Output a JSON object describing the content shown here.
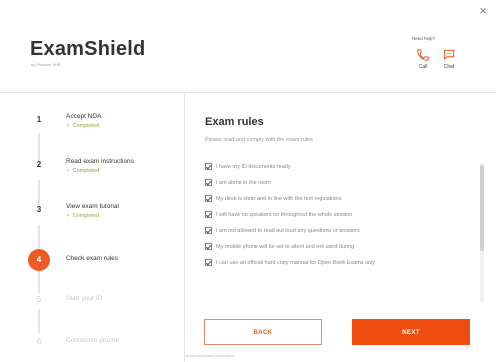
{
  "window": {
    "close_glyph": "×"
  },
  "header": {
    "logo": "ExamShield",
    "logo_sub": "by Pearson VUE",
    "help_title": "Need help?",
    "call_label": "Call",
    "chat_label": "Chat"
  },
  "colors": {
    "accent": "#f04e10",
    "active_step": "#ee5a24",
    "completed": "#7cb342"
  },
  "steps": [
    {
      "number": "1",
      "title": "Accept NDA",
      "status": "Completed",
      "state": "completed"
    },
    {
      "number": "2",
      "title": "Read exam instructions",
      "status": "Completed",
      "state": "completed"
    },
    {
      "number": "3",
      "title": "View exam tutorial",
      "status": "Completed",
      "state": "completed"
    },
    {
      "number": "4",
      "title": "Check exam rules",
      "status": "",
      "state": "active"
    },
    {
      "number": "5",
      "title": "Start your ID",
      "status": "",
      "state": "pending"
    },
    {
      "number": "6",
      "title": "Connect to proctor",
      "status": "",
      "state": "pending"
    }
  ],
  "main": {
    "title": "Exam rules",
    "subtitle": "Please read and comply with the exam rules",
    "rules": [
      "I have my ID documents ready",
      "I am alone in the room",
      "My desk is clear and in line with the test regulations",
      "I will have no speakers on throughout the whole session",
      "I am not allowed to read out loud any questions or answers",
      "My mobile phone will be set to silent and not used during",
      "I can use an official hard copy manual for Open Book Exams only"
    ],
    "back_label": "BACK",
    "next_label": "NEXT"
  },
  "footer": {
    "text": "Version and privacy information"
  }
}
